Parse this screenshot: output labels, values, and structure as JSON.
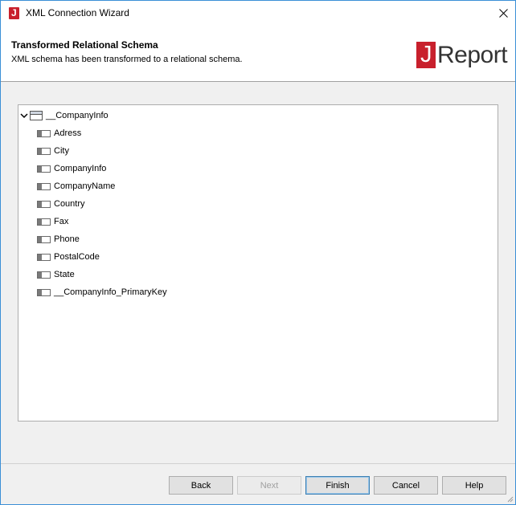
{
  "window": {
    "title": "XML Connection Wizard",
    "icons": {
      "app": "jreport-app-icon",
      "close": "close-icon"
    }
  },
  "header": {
    "title": "Transformed Relational Schema",
    "subtitle": "XML schema has been transformed to a relational schema.",
    "logo": {
      "j": "J",
      "rest": "Report"
    }
  },
  "tree": {
    "root": {
      "label": "__CompanyInfo",
      "expanded": true,
      "icon": "table-icon"
    },
    "columns": [
      "Adress",
      "City",
      "CompanyInfo",
      "CompanyName",
      "Country",
      "Fax",
      "Phone",
      "PostalCode",
      "State",
      "__CompanyInfo_PrimaryKey"
    ]
  },
  "buttons": {
    "back": "Back",
    "next": "Next",
    "finish": "Finish",
    "cancel": "Cancel",
    "help": "Help"
  },
  "colors": {
    "accent": "#c8202c",
    "window_border": "#3b8fd6",
    "dialog_bg": "#f0f0f0"
  }
}
